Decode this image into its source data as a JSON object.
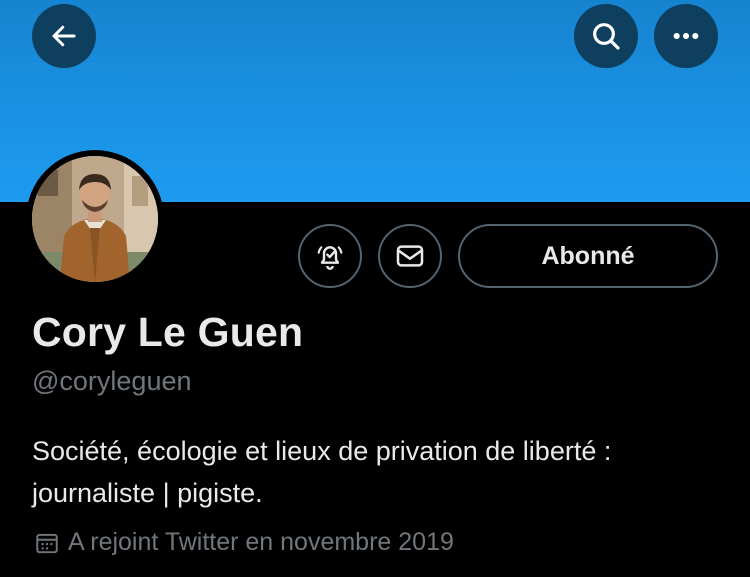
{
  "header": {
    "back_icon": "arrow-left-icon",
    "search_icon": "search-icon",
    "more_icon": "more-horizontal-icon",
    "banner_color": "#1d9bf0"
  },
  "profile": {
    "name": "Cory Le Guen",
    "handle": "@coryleguen",
    "bio_line1": "Société, écologie et lieux de privation de liberté :",
    "bio_line2": "journaliste | pigiste.",
    "joined": "A rejoint Twitter en novembre 2019",
    "follow_label": "Abonné",
    "notification_icon": "bell-check-icon",
    "message_icon": "envelope-icon",
    "calendar_icon": "calendar-icon"
  }
}
